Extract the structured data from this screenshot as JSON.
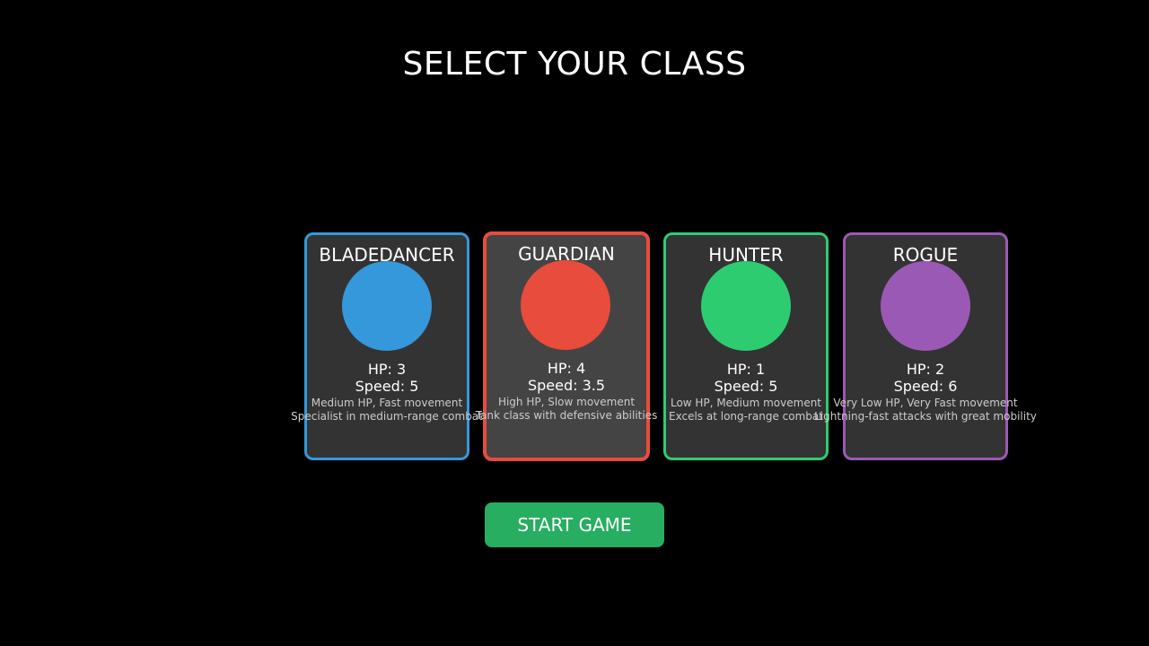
{
  "screen": {
    "title": "SELECT YOUR CLASS"
  },
  "classes": [
    {
      "name": "BLADEDANCER",
      "hp_label": "HP: 3",
      "speed_label": "Speed: 5",
      "desc_1": "Medium HP, Fast movement",
      "desc_2": "Specialist in medium-range combat",
      "color": "#3498db",
      "selected": false
    },
    {
      "name": "GUARDIAN",
      "hp_label": "HP: 4",
      "speed_label": "Speed: 3.5",
      "desc_1": "High HP, Slow movement",
      "desc_2": "Tank class with defensive abilities",
      "color": "#e74c3c",
      "selected": true
    },
    {
      "name": "HUNTER",
      "hp_label": "HP: 1",
      "speed_label": "Speed: 5",
      "desc_1": "Low HP, Medium movement",
      "desc_2": "Excels at long-range combat",
      "color": "#2ecc71",
      "selected": false
    },
    {
      "name": "ROGUE",
      "hp_label": "HP: 2",
      "speed_label": "Speed: 6",
      "desc_1": "Very Low HP, Very Fast movement",
      "desc_2": "Lightning-fast attacks with great mobility",
      "color": "#9b59b6",
      "selected": false
    }
  ],
  "actions": {
    "start_label": "START GAME",
    "start_color": "#27ae60"
  },
  "theme": {
    "background": "#000000",
    "card_background": "#333333",
    "card_selected_background": "#444444",
    "desc_color": "#cccccc"
  }
}
